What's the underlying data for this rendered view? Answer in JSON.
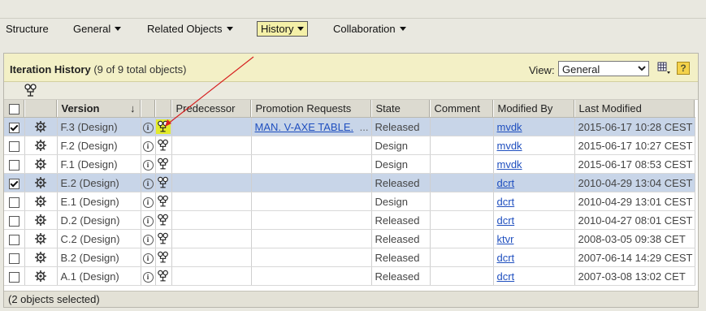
{
  "menu": {
    "items": [
      {
        "label": "Structure",
        "dropdown": false
      },
      {
        "label": "General",
        "dropdown": true
      },
      {
        "label": "Related Objects",
        "dropdown": true
      },
      {
        "label": "History",
        "dropdown": true,
        "active": true
      },
      {
        "label": "Collaboration",
        "dropdown": true
      }
    ]
  },
  "panel": {
    "title": "Iteration History",
    "count": "(9 of 9 total objects)",
    "view_label": "View:",
    "view_value": "General",
    "help_label": "?"
  },
  "table": {
    "columns": [
      "",
      "",
      "Version",
      "",
      "",
      "Predecessor",
      "Promotion Requests",
      "State",
      "Comment",
      "Modified By",
      "Last Modified"
    ],
    "sort_indicator": "↓",
    "rows": [
      {
        "checked": true,
        "version": "F.3 (Design)",
        "predecessor": "",
        "promotion": "MAN. V-AXE TABLE.",
        "promotion_more": "...",
        "state": "Released",
        "comment": "",
        "modified_by": "mvdk",
        "last_modified": "2015-06-17 10:28 CEST",
        "highlight_icon": true
      },
      {
        "checked": false,
        "version": "F.2 (Design)",
        "predecessor": "",
        "promotion": "",
        "promotion_more": "",
        "state": "Design",
        "comment": "",
        "modified_by": "mvdk",
        "last_modified": "2015-06-17 10:27 CEST",
        "highlight_icon": false
      },
      {
        "checked": false,
        "version": "F.1 (Design)",
        "predecessor": "",
        "promotion": "",
        "promotion_more": "",
        "state": "Design",
        "comment": "",
        "modified_by": "mvdk",
        "last_modified": "2015-06-17 08:53 CEST",
        "highlight_icon": false
      },
      {
        "checked": true,
        "version": "E.2 (Design)",
        "predecessor": "",
        "promotion": "",
        "promotion_more": "",
        "state": "Released",
        "comment": "",
        "modified_by": "dcrt",
        "last_modified": "2010-04-29 13:04 CEST",
        "highlight_icon": false
      },
      {
        "checked": false,
        "version": "E.1 (Design)",
        "predecessor": "",
        "promotion": "",
        "promotion_more": "",
        "state": "Design",
        "comment": "",
        "modified_by": "dcrt",
        "last_modified": "2010-04-29 13:01 CEST",
        "highlight_icon": false
      },
      {
        "checked": false,
        "version": "D.2 (Design)",
        "predecessor": "",
        "promotion": "",
        "promotion_more": "",
        "state": "Released",
        "comment": "",
        "modified_by": "dcrt",
        "last_modified": "2010-04-27 08:01 CEST",
        "highlight_icon": false
      },
      {
        "checked": false,
        "version": "C.2 (Design)",
        "predecessor": "",
        "promotion": "",
        "promotion_more": "",
        "state": "Released",
        "comment": "",
        "modified_by": "ktvr",
        "last_modified": "2008-03-05 09:38 CET",
        "highlight_icon": false
      },
      {
        "checked": false,
        "version": "B.2 (Design)",
        "predecessor": "",
        "promotion": "",
        "promotion_more": "",
        "state": "Released",
        "comment": "",
        "modified_by": "dcrt",
        "last_modified": "2007-06-14 14:29 CEST",
        "highlight_icon": false
      },
      {
        "checked": false,
        "version": "A.1 (Design)",
        "predecessor": "",
        "promotion": "",
        "promotion_more": "",
        "state": "Released",
        "comment": "",
        "modified_by": "dcrt",
        "last_modified": "2007-03-08 13:02 CET",
        "highlight_icon": false
      }
    ]
  },
  "status": {
    "text": "(2 objects selected)"
  },
  "icons": {
    "row_action": "gear-icon",
    "row_info": "info-icon",
    "row_structure": "structure-tree-icon",
    "toolbar": "structure-tree-icon",
    "grid": "table-layout-icon"
  },
  "colors": {
    "selected_row": "#c8d5e8",
    "header_band": "#f3f0c6",
    "annotation_arrow": "#d62020",
    "highlight": "#e2ea2c"
  }
}
